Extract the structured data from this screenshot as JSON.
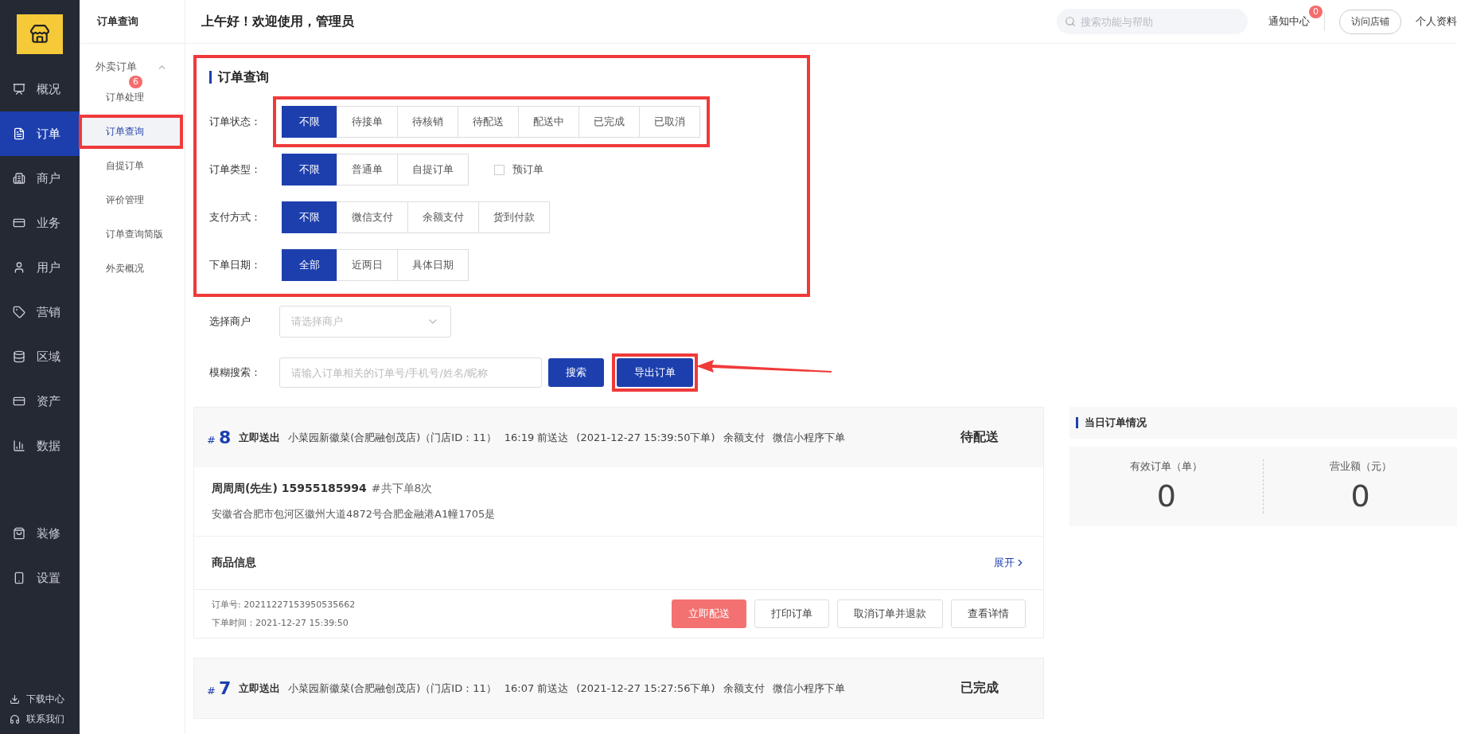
{
  "nav": [
    {
      "label": "概况",
      "selected": false
    },
    {
      "label": "订单",
      "selected": true
    },
    {
      "label": "商户",
      "selected": false
    },
    {
      "label": "业务",
      "selected": false
    },
    {
      "label": "用户",
      "selected": false
    },
    {
      "label": "营销",
      "selected": false
    },
    {
      "label": "区域",
      "selected": false
    },
    {
      "label": "资产",
      "selected": false
    },
    {
      "label": "数据",
      "selected": false
    }
  ],
  "nav_extra": [
    {
      "label": "装修",
      "selected": false
    },
    {
      "label": "设置",
      "selected": false
    }
  ],
  "nav_footer": [
    "下载中心",
    "联系我们"
  ],
  "submenu": {
    "title": "订单查询",
    "group": {
      "label": "外卖订单",
      "expanded": true,
      "items": [
        {
          "label": "订单处理",
          "selected": false,
          "badge": "6"
        },
        {
          "label": "订单查询",
          "selected": true
        },
        {
          "label": "自提订单",
          "selected": false
        },
        {
          "label": "评价管理",
          "selected": false
        },
        {
          "label": "订单查询简版",
          "selected": false
        },
        {
          "label": "外卖概况",
          "selected": false
        }
      ]
    }
  },
  "header": {
    "greeting": "上午好！欢迎使用，管理员",
    "search": {
      "placeholder": "搜索功能与帮助"
    },
    "notice": {
      "label": "通知中心",
      "badge": "0"
    },
    "visit_button": "访问店铺",
    "profile": "个人资料"
  },
  "filters": {
    "title": "订单查询",
    "rows": [
      {
        "label": "订单状态：",
        "highlighted": true,
        "options": [
          {
            "label": "不限",
            "selected": true
          },
          {
            "label": "待接单",
            "selected": false
          },
          {
            "label": "待核销",
            "selected": false
          },
          {
            "label": "待配送",
            "selected": false
          },
          {
            "label": "配送中",
            "selected": false
          },
          {
            "label": "已完成",
            "selected": false
          },
          {
            "label": "已取消",
            "selected": false
          }
        ]
      },
      {
        "label": "订单类型：",
        "highlighted": false,
        "options": [
          {
            "label": "不限",
            "selected": true
          },
          {
            "label": "普通单",
            "selected": false
          },
          {
            "label": "自提订单",
            "selected": false
          }
        ],
        "checkbox": {
          "label": "预订单",
          "checked": false
        }
      },
      {
        "label": "支付方式：",
        "highlighted": false,
        "options": [
          {
            "label": "不限",
            "selected": true
          },
          {
            "label": "微信支付",
            "selected": false
          },
          {
            "label": "余额支付",
            "selected": false
          },
          {
            "label": "货到付款",
            "selected": false
          }
        ]
      },
      {
        "label": "下单日期：",
        "highlighted": false,
        "options": [
          {
            "label": "全部",
            "selected": true
          },
          {
            "label": "近两日",
            "selected": false
          },
          {
            "label": "具体日期",
            "selected": false
          }
        ]
      }
    ]
  },
  "merchant": {
    "label": "选择商户",
    "placeholder": "请选择商户"
  },
  "search": {
    "label": "模糊搜索：",
    "placeholder": "请输入订单相关的订单号/手机号/姓名/昵称",
    "search_button": "搜索",
    "export_button": "导出订单"
  },
  "orders": [
    {
      "hash": "#",
      "number": "8",
      "delivery": "立即送出",
      "info": [
        "小菜园新徽菜(合肥融创茂店)（门店ID：11）",
        "16:19 前送达",
        "(2021-12-27 15:39:50下单)",
        "余额支付",
        "微信小程序下单"
      ],
      "status": "待配送",
      "customer": "周周周(先生) 15955185994",
      "orders_count": "#共下单8次",
      "address": "安徽省合肥市包河区徽州大道4872号合肥金融港A1幢1705是",
      "goods_label": "商品信息",
      "expand": "展开",
      "order_no": "订单号: 20211227153950535662",
      "order_time": "下单时间：2021-12-27 15:39:50",
      "actions": [
        {
          "label": "立即配送",
          "kind": "danger"
        },
        {
          "label": "打印订单",
          "kind": "default"
        },
        {
          "label": "取消订单并退款",
          "kind": "default"
        },
        {
          "label": "查看详情",
          "kind": "default"
        }
      ]
    },
    {
      "hash": "#",
      "number": "7",
      "delivery": "立即送出",
      "info": [
        "小菜园新徽菜(合肥融创茂店)（门店ID：11）",
        "16:07 前送达",
        "(2021-12-27 15:27:56下单)",
        "余额支付",
        "微信小程序下单"
      ],
      "status": "已完成"
    }
  ],
  "today": {
    "title": "当日订单情况",
    "stats": [
      {
        "label": "有效订单（单）",
        "value": "0"
      },
      {
        "label": "营业额（元）",
        "value": "0"
      }
    ]
  }
}
